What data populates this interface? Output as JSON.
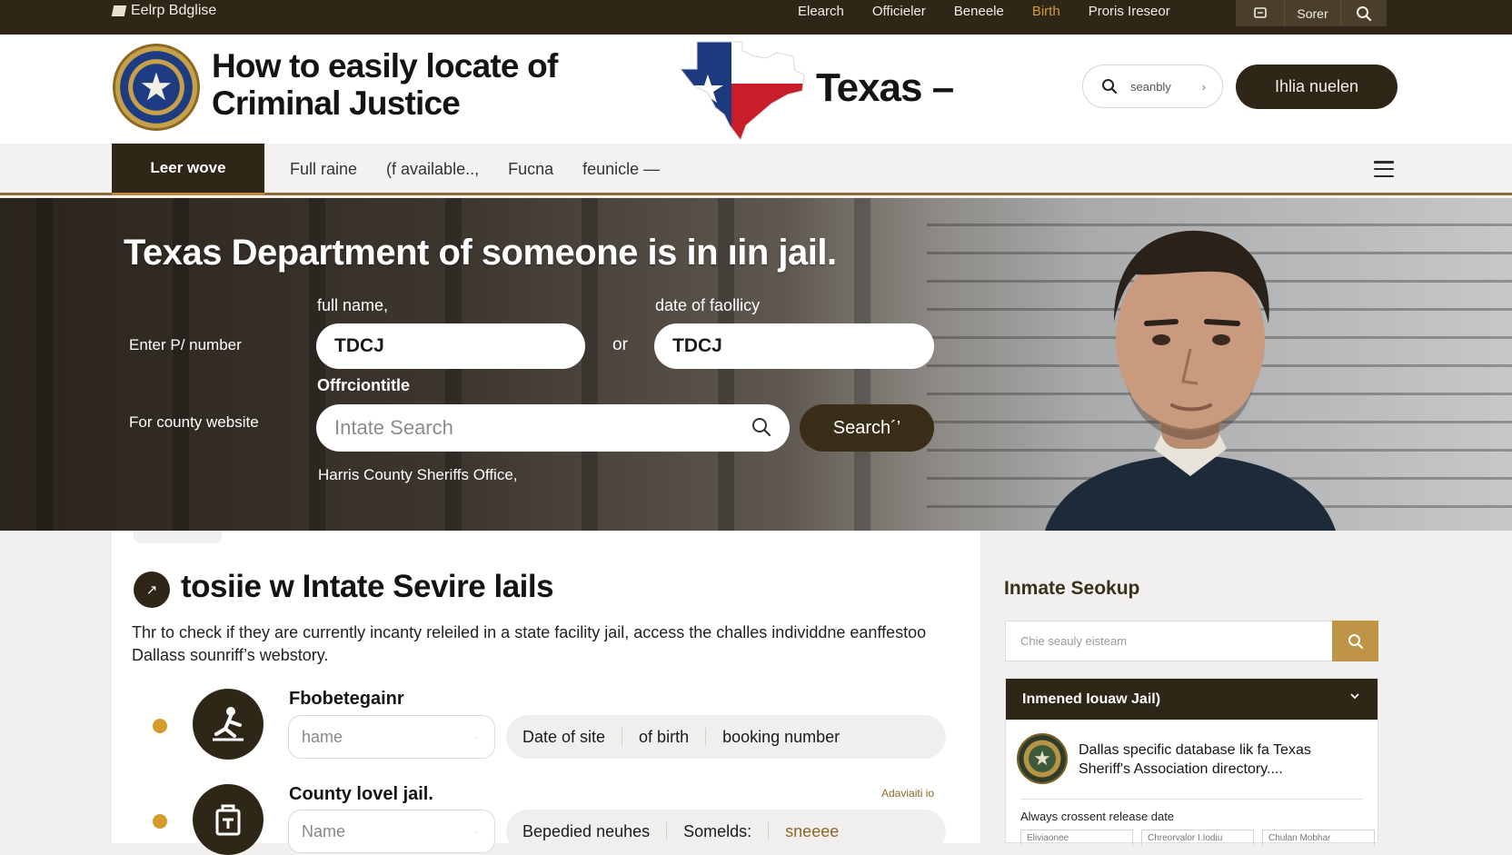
{
  "topbar": {
    "brand": "Eelrp Bdglise",
    "links": [
      "Elearch",
      "Officieler",
      "Beneele",
      "Birth",
      "Proris Ireseor"
    ],
    "active_link": "Birth",
    "save_label": "Sorer"
  },
  "header": {
    "title": "How to easily locate of Criminal Justice",
    "state_label": "Texas –",
    "search_text": "seanbly",
    "cta_label": "Ihlia nuelen"
  },
  "nav": {
    "active": "Leer wove",
    "items": [
      "Full raine",
      "(f available..,",
      "Fucna",
      "feunicle —"
    ]
  },
  "hero": {
    "headline": "Texas Department of someone is in ıin jail.",
    "label_full_name": "full name,",
    "label_date": "date of faollicy",
    "label_enter": "Enter P/ number",
    "value_left": "TDCJ",
    "or_text": "or",
    "value_right": "TDCJ",
    "label_official": "Offrciontitle",
    "label_county": "For county website",
    "search_placeholder": "Intate Search",
    "search_button": "Search´’",
    "office_note": "Harris County Sheriffs Office,"
  },
  "main": {
    "icon_glyph": "↗",
    "title": "tosiie w  Intate Sevire lails",
    "desc": "Thr to check if they are currently incanty releiled in a state facility jail, access the challes individdne eanffestoo  Dallass sounriff’s webstory.",
    "rows": [
      {
        "title": "Fbobetegainr",
        "input_placeholder": "hame",
        "chips": [
          "Date of site",
          "of birth",
          "booking number"
        ],
        "meta": ""
      },
      {
        "title": "County lovel jail.",
        "input_placeholder": "Name",
        "chips": [
          "Bepedied neuhes",
          "Somelds:",
          "sneeee"
        ],
        "meta": "Adaviaiti io"
      }
    ]
  },
  "sidebar": {
    "title": "Inmate Seokup",
    "search_placeholder": "Chie seauly eisteam",
    "card_title": "Inmened  Iouaw Jail)",
    "card_desc": "Dallas specific database lik fa Texas Sheriff's Association directory....",
    "note": "Always crossent release date",
    "minis": [
      "Eliviaonee",
      "Chreorvalor I.Iodiu",
      "Chulan  Mobhar"
    ]
  },
  "colors": {
    "dark_brown": "#2e2617",
    "accent_gold": "#c09446",
    "dot_orange": "#d69a2d",
    "active_link": "#d79b3c"
  }
}
